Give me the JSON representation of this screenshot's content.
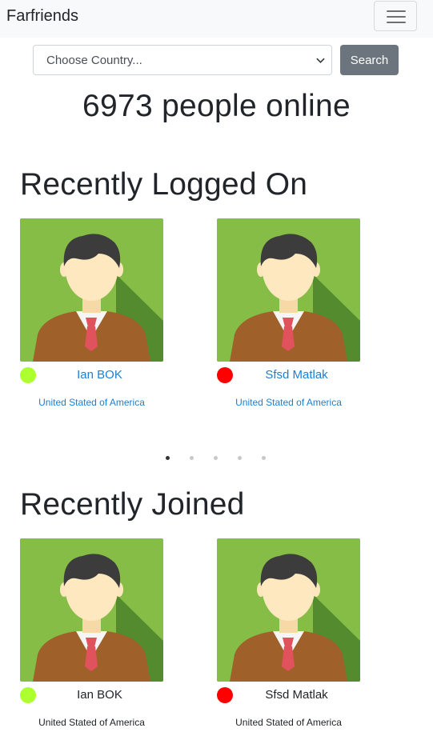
{
  "navbar": {
    "brand": "Farfriends",
    "toggler_icon": "hamburger-menu-icon"
  },
  "search": {
    "country_select": "Choose Country...",
    "button_label": "Search",
    "chevron_icon": "chevron-down-icon"
  },
  "online": {
    "text": "6973 people online"
  },
  "recently_logged_on": {
    "title": "Recently Logged On",
    "cards": [
      {
        "name": "Ian BOK",
        "country": "United Stated of America",
        "status_color": "#adff2f"
      },
      {
        "name": "Sfsd Matlak",
        "country": "United Stated of America",
        "status_color": "#ff0000"
      }
    ],
    "carousel": {
      "count": 5,
      "active_index": 0
    }
  },
  "recently_joined": {
    "title": "Recently Joined",
    "cards": [
      {
        "name": "Ian BOK",
        "country": "United Stated of America",
        "status_color": "#adff2f"
      },
      {
        "name": "Sfsd Matlak",
        "country": "United Stated of America",
        "status_color": "#ff0000"
      }
    ]
  },
  "colors": {
    "link": "#1a7fd6",
    "button_bg": "#6c757d",
    "navbar_bg": "#f8f9fa",
    "avatar_bg": "#8bc34a"
  }
}
